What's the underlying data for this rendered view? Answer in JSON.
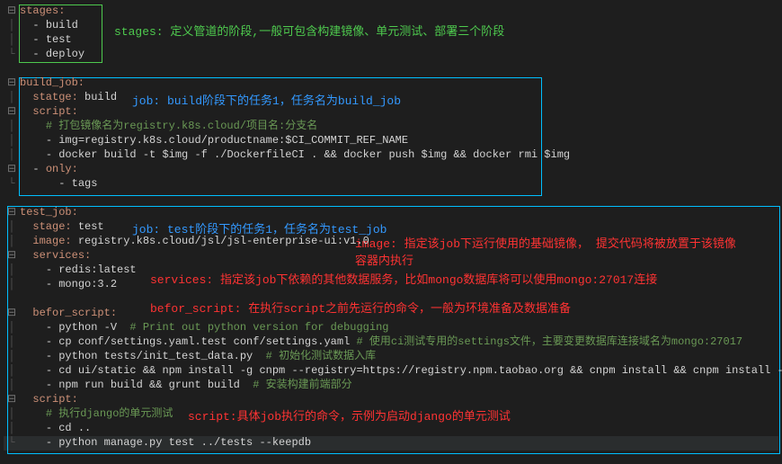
{
  "code": {
    "l1": "stages:",
    "l2": "build",
    "l3": "test",
    "l4": "deploy",
    "l5": "build_job:",
    "l6": "statge:",
    "l6v": "build",
    "l7": "script:",
    "l8": "# 打包镜像名为registry.k8s.cloud/项目名:分支名",
    "l9": "img=registry.k8s.cloud/productname:$CI_COMMIT_REF_NAME",
    "l10": "docker build -t $img -f ./DockerfileCI . && docker push $img && docker rmi $img",
    "l11": "only:",
    "l12": "tags",
    "l13": "test_job:",
    "l14": "stage:",
    "l14v": "test",
    "l15": "image:",
    "l15v": "registry.k8s.cloud/jsl/jsl-enterprise-ui:v1.0",
    "l16": "services:",
    "l17": "redis:latest",
    "l18": "mongo:3.2",
    "l19": "befor_script:",
    "l20a": "python -V",
    "l20c": "  # Print out python version for debugging",
    "l21a": "cp conf/settings.yaml.test conf/settings.yaml",
    "l21c": " # 使用ci测试专用的settings文件，主要变更数据库连接域名为mongo:27017",
    "l22a": "python tests/init_test_data.py",
    "l22c": "  # 初始化测试数据入库",
    "l23": "cd ui/static && npm install -g cnpm --registry=https://registry.npm.taobao.org && cnpm install && cnpm install -g grunt",
    "l24a": "npm run build && grunt build",
    "l24c": "  # 安装构建前端部分",
    "l25": "script:",
    "l26": "# 执行django的单元测试",
    "l27": "cd ..",
    "l28": "python manage.py test ../tests --keepdb"
  },
  "annotations": {
    "a1": "stages: 定义管道的阶段,一般可包含构建镜像、单元测试、部署三个阶段",
    "a2": "job: build阶段下的任务1，任务名为build_job",
    "a3": "job: test阶段下的任务1，任务名为test_job",
    "a4": "image: 指定该job下运行使用的基础镜像， 提交代码将被放置于该镜像容器内执行",
    "a5": "services: 指定该job下依赖的其他数据服务，比如mongo数据库将可以使用mongo:27017连接",
    "a6": "befor_script: 在执行script之前先运行的命令，一般为环境准备及数据准备",
    "a7": "script:具体job执行的命令，示例为启动django的单元测试"
  }
}
